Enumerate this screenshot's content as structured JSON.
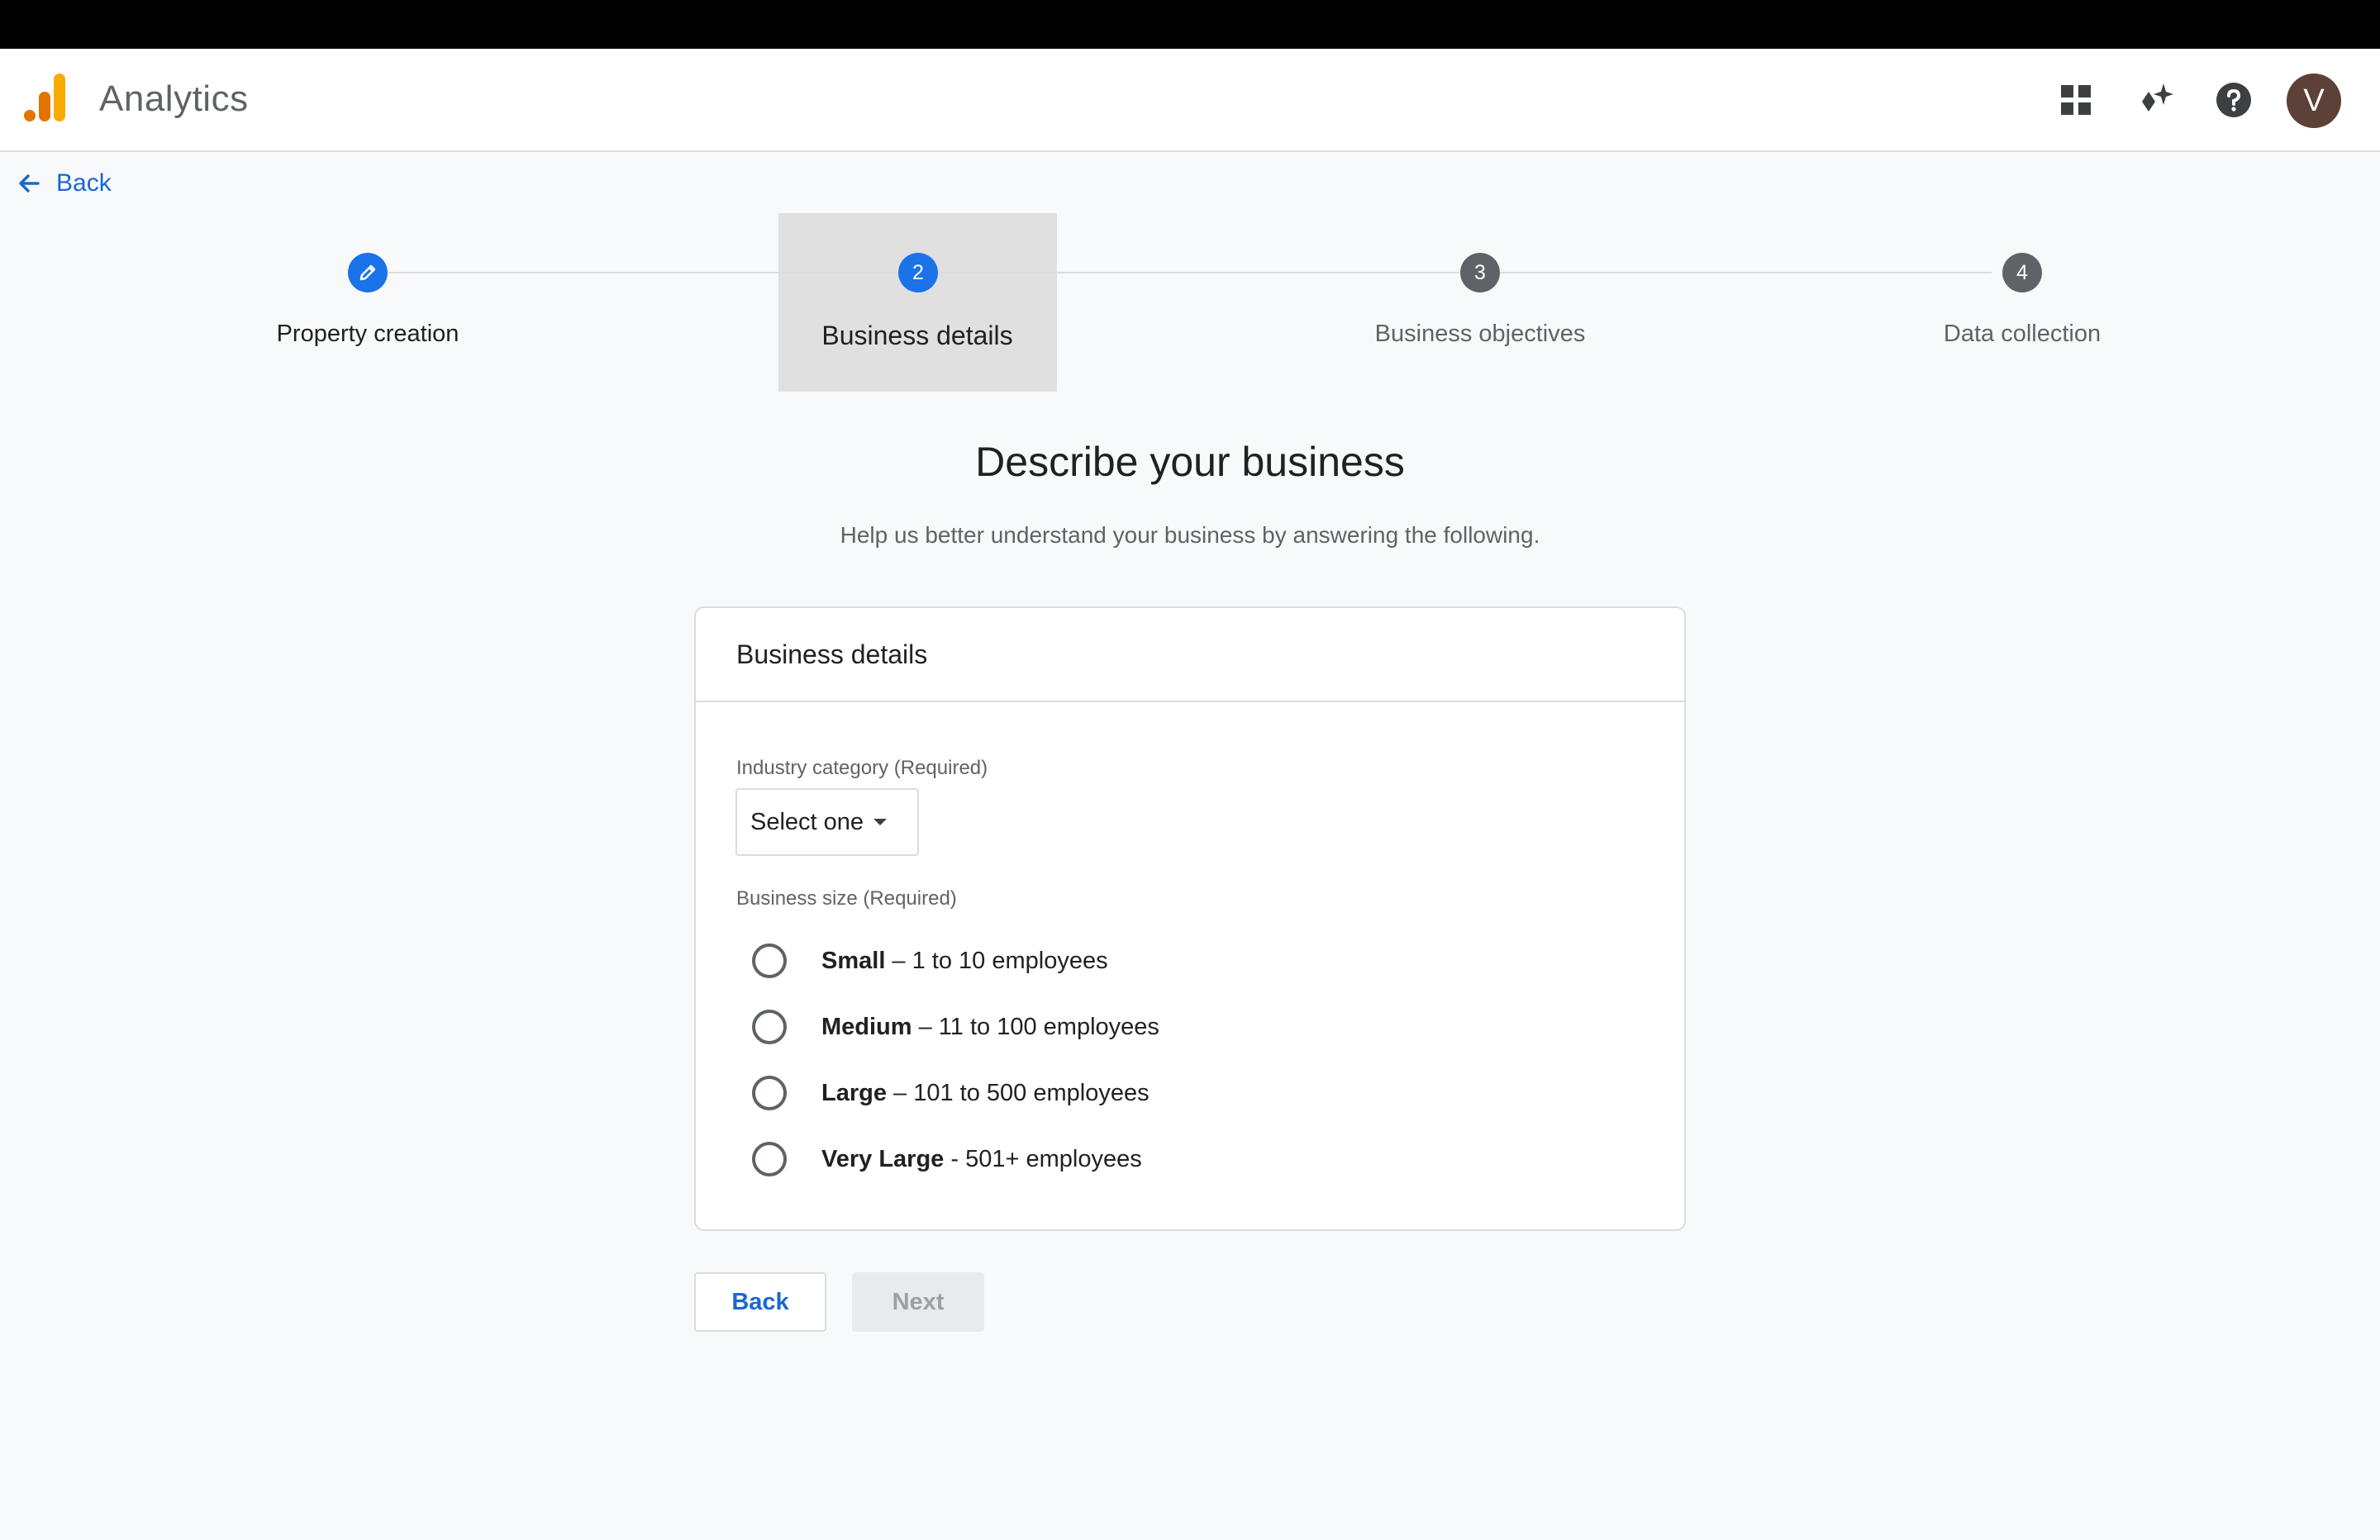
{
  "header": {
    "app_title": "Analytics",
    "icons": [
      "apps-grid-icon",
      "sparkle-icon",
      "help-icon"
    ],
    "avatar_initial": "V",
    "avatar_color": "#5d4037"
  },
  "nav": {
    "back_label": "Back"
  },
  "stepper": {
    "steps": [
      {
        "number": "",
        "label": "Property creation",
        "state": "completed"
      },
      {
        "number": "2",
        "label": "Business details",
        "state": "current"
      },
      {
        "number": "3",
        "label": "Business objectives",
        "state": "upcoming"
      },
      {
        "number": "4",
        "label": "Data collection",
        "state": "upcoming"
      }
    ],
    "active_color": "#1a73e8",
    "inactive_color": "#5f6368"
  },
  "page": {
    "heading": "Describe your business",
    "subheading": "Help us better understand your business by answering the following."
  },
  "card": {
    "title": "Business details",
    "industry": {
      "label": "Industry category (Required)",
      "value": "Select one"
    },
    "size": {
      "label": "Business size (Required)",
      "options": [
        {
          "name": "Small",
          "detail": " – 1 to 10 employees"
        },
        {
          "name": "Medium",
          "detail": " – 11 to 100 employees"
        },
        {
          "name": "Large",
          "detail": " – 101 to 500 employees"
        },
        {
          "name": "Very Large",
          "detail": " - 501+ employees"
        }
      ]
    }
  },
  "actions": {
    "back_label": "Back",
    "next_label": "Next"
  }
}
